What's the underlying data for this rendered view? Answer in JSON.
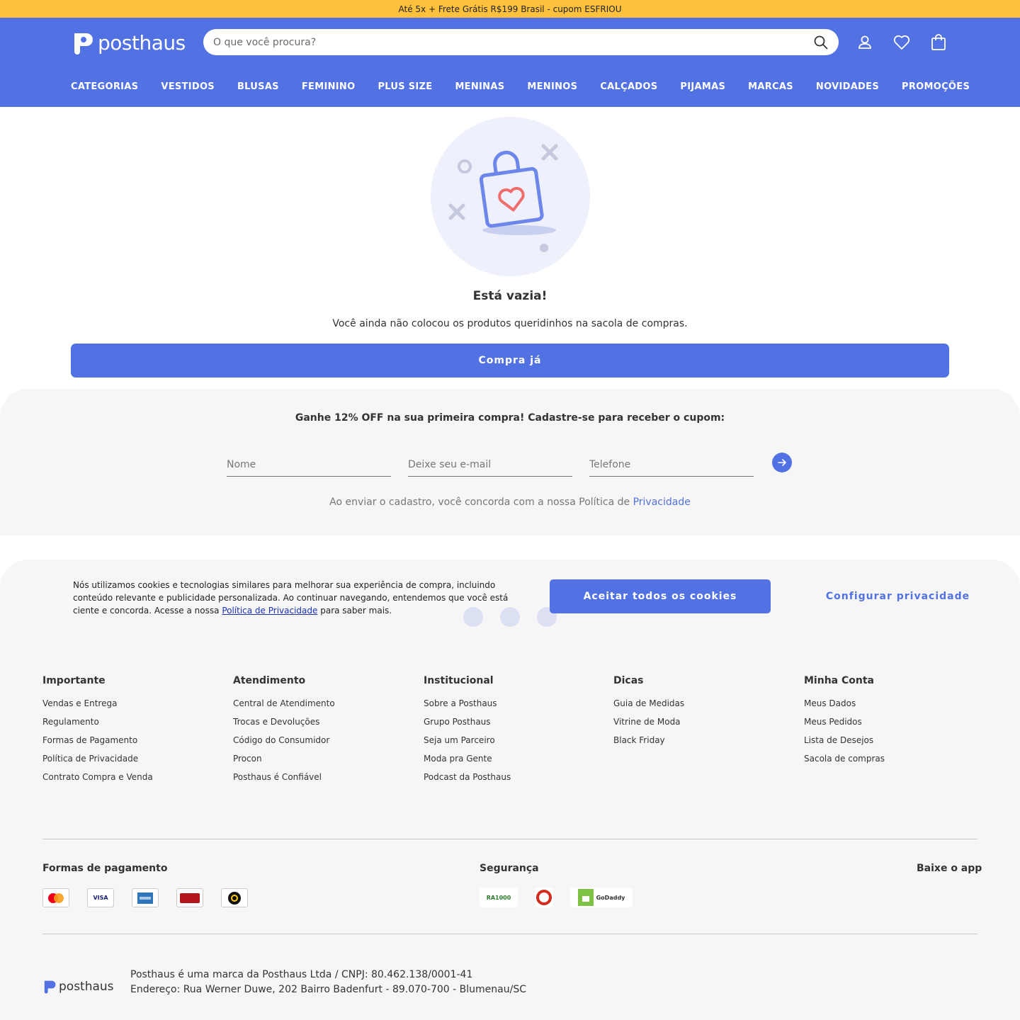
{
  "topbar": {
    "text": "Até 5x + Frete Grátis R$199 Brasil - cupom ESFRIOU"
  },
  "header": {
    "logo_text": "posthaus",
    "search_placeholder": "O que você procura?",
    "nav": [
      "CATEGORIAS",
      "VESTIDOS",
      "BLUSAS",
      "FEMININO",
      "PLUS SIZE",
      "MENINAS",
      "MENINOS",
      "CALÇADOS",
      "PIJAMAS",
      "MARCAS",
      "NOVIDADES",
      "PROMOÇÕES"
    ]
  },
  "empty": {
    "title": "Está vazia!",
    "text": "Você ainda não colocou os produtos queridinhos na sacola de compras.",
    "button": "Compra já"
  },
  "newsletter": {
    "title": "Ganhe 12% OFF na sua primeira compra! Cadastre-se para receber o cupom:",
    "name_placeholder": "Nome",
    "email_placeholder": "Deixe seu e-mail",
    "phone_placeholder": "Telefone",
    "legal_text": "Ao enviar o cadastro, você concorda com a nossa Política de",
    "legal_link": "Privacidade"
  },
  "cookie": {
    "text_before": "Nós utilizamos cookies e tecnologias similares para melhorar sua experiência de compra, incluindo conteúdo relevante e publicidade personalizada. Ao continuar navegando, entendemos que você está ciente e concorda. Acesse a nossa",
    "link": "Política de Privacidade",
    "text_after": "para saber mais.",
    "accept": "Aceitar todos os cookies",
    "configure": "Configurar privacidade"
  },
  "footer": {
    "columns": [
      {
        "title": "Importante",
        "links": [
          "Vendas e Entrega",
          "Regulamento",
          "Formas de Pagamento",
          "Política de Privacidade",
          "Contrato Compra e Venda"
        ]
      },
      {
        "title": "Atendimento",
        "links": [
          "Central de Atendimento",
          "Trocas e Devoluções",
          "Código do Consumidor",
          "Procon",
          "Posthaus é Confiável"
        ]
      },
      {
        "title": "Institucional",
        "links": [
          "Sobre a Posthaus",
          "Grupo Posthaus",
          "Seja um Parceiro",
          "Moda pra Gente",
          "Podcast da Posthaus"
        ]
      },
      {
        "title": "Dicas",
        "links": [
          "Guia de Medidas",
          "Vitrine de Moda",
          "Black Friday"
        ]
      },
      {
        "title": "Minha Conta",
        "links": [
          "Meus Dados",
          "Meus Pedidos",
          "Lista de Desejos",
          "Sacola de compras"
        ]
      }
    ],
    "payments_title": "Formas de pagamento",
    "payment_cards": [
      "MasterCard",
      "VISA",
      "American Express",
      "Hipercard",
      "elo"
    ],
    "security_title": "Segurança",
    "security_seals": [
      "RA1000",
      "e-bit",
      "GoDaddy"
    ],
    "app_title": "Baixe o app",
    "company_line1": "Posthaus é uma marca da Posthaus Ltda / CNPJ: 80.462.138/0001-41",
    "company_line2": "Endereço: Rua Werner Duwe, 202 Bairro Badenfurt - 89.070-700 - Blumenau/SC",
    "logo_text": "posthaus"
  },
  "colors": {
    "brand": "#5271e3",
    "topbar": "#fdc13e",
    "footer_bg": "#f6f6f6"
  }
}
